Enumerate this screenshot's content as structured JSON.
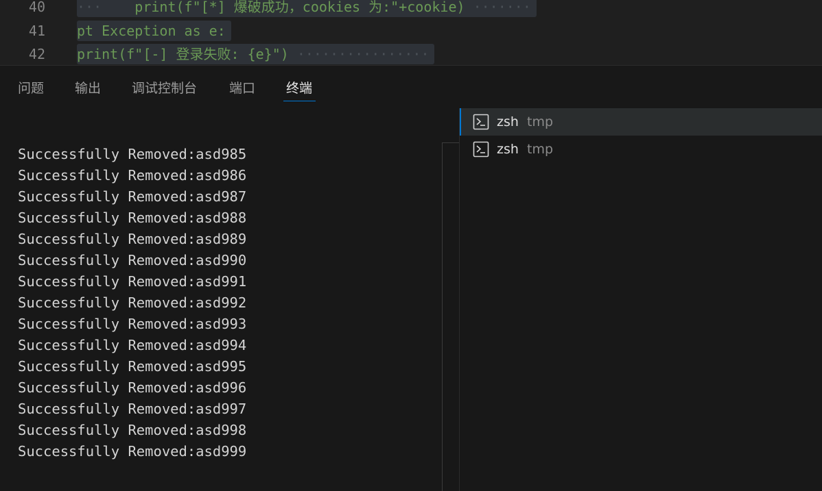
{
  "editor": {
    "lines": [
      {
        "number": "40",
        "lead": "    ",
        "text": "print(f\"[*] 爆破成功，cookies 为:\"+cookie)",
        "trail": " ·······"
      },
      {
        "number": "41",
        "lead": "",
        "text": "pt Exception as e:",
        "trail": ""
      },
      {
        "number": "42",
        "lead": "",
        "text": "print(f\"[-] 登录失败: {e}\")",
        "trail": " ················"
      }
    ]
  },
  "panel": {
    "tabs": [
      {
        "label": "问题"
      },
      {
        "label": "输出"
      },
      {
        "label": "调试控制台"
      },
      {
        "label": "端口"
      },
      {
        "label": "终端",
        "active": true
      }
    ]
  },
  "terminal": {
    "lines": [
      "Successfully Removed:asd985",
      "Successfully Removed:asd986",
      "Successfully Removed:asd987",
      "Successfully Removed:asd988",
      "Successfully Removed:asd989",
      "Successfully Removed:asd990",
      "Successfully Removed:asd991",
      "Successfully Removed:asd992",
      "Successfully Removed:asd993",
      "Successfully Removed:asd994",
      "Successfully Removed:asd995",
      "Successfully Removed:asd996",
      "Successfully Removed:asd997",
      "Successfully Removed:asd998",
      "Successfully Removed:asd999"
    ]
  },
  "terminal_list": {
    "items": [
      {
        "icon": "terminal-icon",
        "name": "zsh",
        "cwd": "tmp",
        "active": true
      },
      {
        "icon": "terminal-icon",
        "name": "zsh",
        "cwd": "tmp",
        "active": false
      }
    ]
  },
  "colors": {
    "accent": "#0078d4",
    "code_green": "#6a9955",
    "panel_bg": "#181818"
  }
}
